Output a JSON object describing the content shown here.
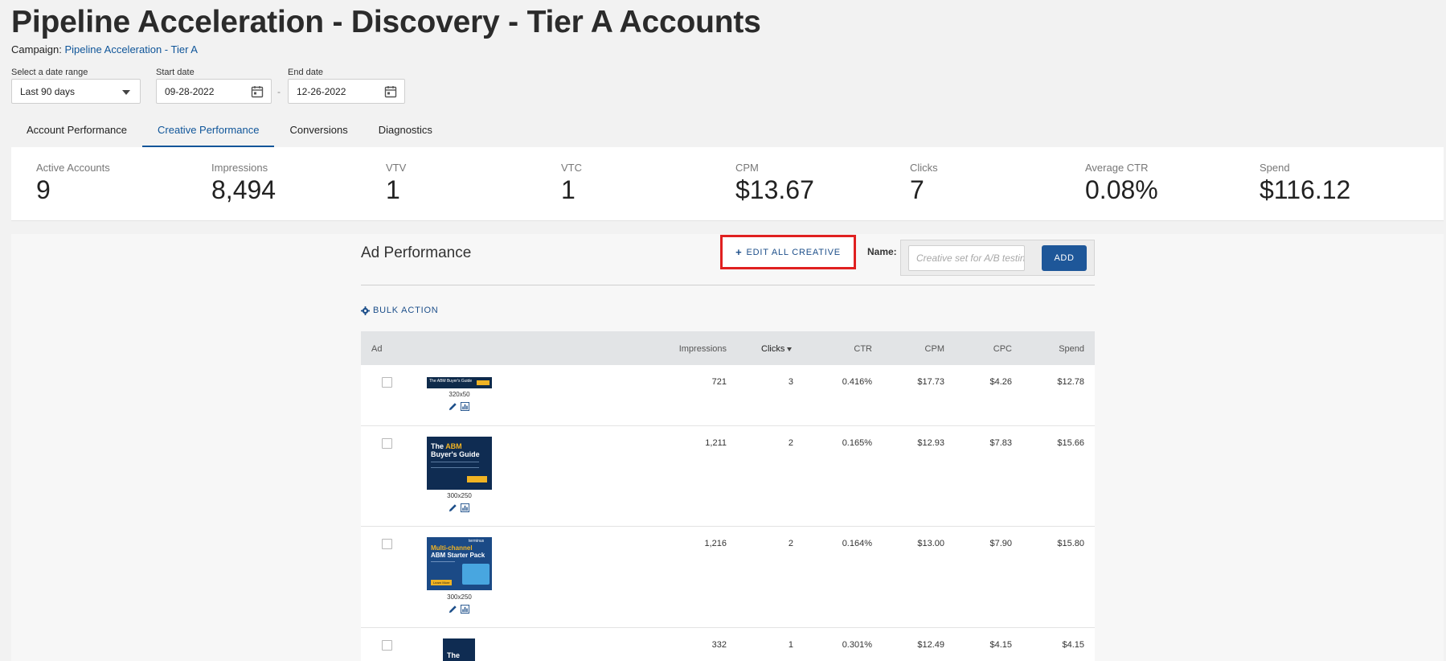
{
  "header": {
    "title": "Pipeline Acceleration - Discovery - Tier A Accounts",
    "campaign_label": "Campaign:",
    "campaign_link": "Pipeline Acceleration - Tier A"
  },
  "filters": {
    "date_range_label": "Select a date range",
    "date_range_value": "Last 90 days",
    "start_label": "Start date",
    "start_value": "09-28-2022",
    "end_label": "End date",
    "end_value": "12-26-2022",
    "separator": "-"
  },
  "tabs": [
    {
      "label": "Account Performance",
      "active": false
    },
    {
      "label": "Creative Performance",
      "active": true
    },
    {
      "label": "Conversions",
      "active": false
    },
    {
      "label": "Diagnostics",
      "active": false
    }
  ],
  "stats": [
    {
      "label": "Active Accounts",
      "value": "9"
    },
    {
      "label": "Impressions",
      "value": "8,494"
    },
    {
      "label": "VTV",
      "value": "1"
    },
    {
      "label": "VTC",
      "value": "1"
    },
    {
      "label": "CPM",
      "value": "$13.67"
    },
    {
      "label": "Clicks",
      "value": "7"
    },
    {
      "label": "Average CTR",
      "value": "0.08%"
    },
    {
      "label": "Spend",
      "value": "$116.12"
    }
  ],
  "ad_performance": {
    "title": "Ad Performance",
    "edit_all_label": "EDIT ALL CREATIVE",
    "name_label": "Name:",
    "name_placeholder": "Creative set for A/B testing",
    "add_label": "ADD",
    "bulk_action_label": "BULK ACTION",
    "columns": {
      "ad": "Ad",
      "impressions": "Impressions",
      "clicks": "Clicks",
      "ctr": "CTR",
      "cpm": "CPM",
      "cpc": "CPC",
      "spend": "Spend"
    },
    "rows": [
      {
        "size": "320x50",
        "impressions": "721",
        "clicks": "3",
        "ctr": "0.416%",
        "cpm": "$17.73",
        "cpc": "$4.26",
        "spend": "$12.78"
      },
      {
        "size": "300x250",
        "impressions": "1,211",
        "clicks": "2",
        "ctr": "0.165%",
        "cpm": "$12.93",
        "cpc": "$7.83",
        "spend": "$15.66"
      },
      {
        "size": "300x250",
        "impressions": "1,216",
        "clicks": "2",
        "ctr": "0.164%",
        "cpm": "$13.00",
        "cpc": "$7.90",
        "spend": "$15.80"
      },
      {
        "size": "",
        "impressions": "332",
        "clicks": "1",
        "ctr": "0.301%",
        "cpm": "$12.49",
        "cpc": "$4.15",
        "spend": "$4.15"
      }
    ]
  },
  "creatives": {
    "banner_text": "The ABM Buyer's Guide",
    "ad2_line1": "The",
    "ad2_line1_hl": "ABM",
    "ad2_line2": "Buyer's Guide",
    "ad3_brand": "terminus",
    "ad3_line1": "Multi-channel",
    "ad3_line2": "ABM Starter Pack",
    "ad3_cta": "Learn More",
    "ad4_line1": "The"
  }
}
